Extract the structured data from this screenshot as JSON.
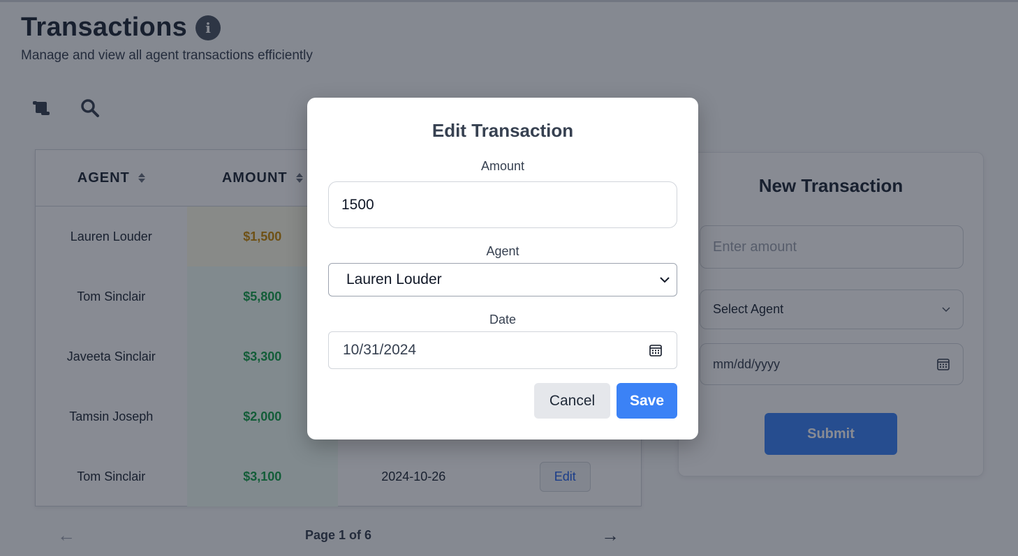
{
  "header": {
    "title": "Transactions",
    "info_icon": "i",
    "subtitle": "Manage and view all agent transactions efficiently"
  },
  "toolbar": {
    "icons": [
      "scroll-icon",
      "search-icon"
    ]
  },
  "table": {
    "columns": [
      "AGENT",
      "AMOUNT"
    ],
    "rows": [
      {
        "agent": "Lauren Louder",
        "amount": "$1,500",
        "date": "",
        "action": ""
      },
      {
        "agent": "Tom Sinclair",
        "amount": "$5,800",
        "date": "",
        "action": ""
      },
      {
        "agent": "Javeeta Sinclair",
        "amount": "$3,300",
        "date": "",
        "action": ""
      },
      {
        "agent": "Tamsin Joseph",
        "amount": "$2,000",
        "date": "",
        "action": ""
      },
      {
        "agent": "Tom Sinclair",
        "amount": "$3,100",
        "date": "2024-10-26",
        "action": "Edit"
      }
    ]
  },
  "pagination": {
    "label": "Page 1 of 6",
    "prev": "←",
    "next": "→"
  },
  "new_transaction": {
    "title": "New Transaction",
    "amount_placeholder": "Enter amount",
    "agent_placeholder": "Select Agent",
    "date_placeholder": "mm/dd/yyyy",
    "submit_label": "Submit"
  },
  "modal": {
    "title": "Edit Transaction",
    "amount_label": "Amount",
    "amount_value": "1500",
    "agent_label": "Agent",
    "agent_value": "Lauren Louder",
    "date_label": "Date",
    "date_value": "10/31/2024",
    "cancel_label": "Cancel",
    "save_label": "Save"
  },
  "colors": {
    "primary": "#3b82f6",
    "amount_green": "#16a34a",
    "amount_warn": "#ca8a04"
  }
}
